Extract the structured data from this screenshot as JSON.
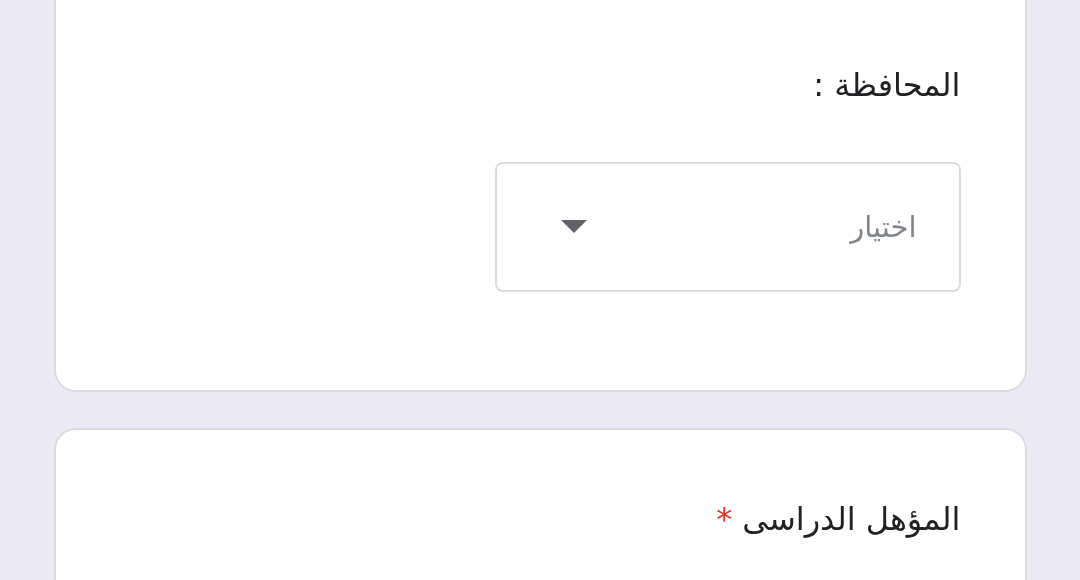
{
  "required_mark": "*",
  "questions": [
    {
      "label": "المحافظة :",
      "required": false,
      "kind": "dropdown",
      "placeholder": "اختيار"
    },
    {
      "label": "المؤهل الدراسى",
      "required": true,
      "kind": "question"
    }
  ]
}
